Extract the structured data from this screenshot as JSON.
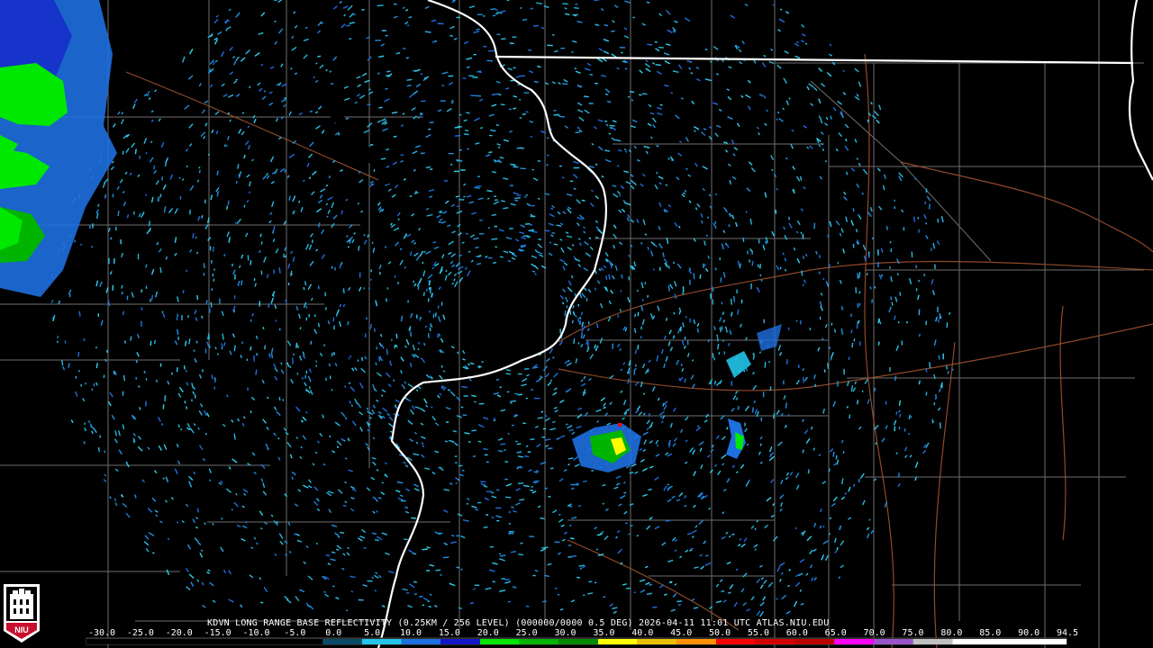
{
  "product": {
    "caption": "KDVN LONG RANGE BASE REFLECTIVITY (0.25KM / 256 LEVEL) (000000/0000 0.5 DEG) 2026-04-11 11:01 UTC  ATLAS.NIU.EDU"
  },
  "logo": {
    "text": "NIU",
    "icon": "niu-tower-logo-icon"
  },
  "scale": {
    "min": -30.0,
    "max": 94.5,
    "tick_labels": [
      "-30.0",
      "-25.0",
      "-20.0",
      "-15.0",
      "-10.0",
      "-5.0",
      "0.0",
      "5.0",
      "10.0",
      "15.0",
      "20.0",
      "25.0",
      "30.0",
      "35.0",
      "40.0",
      "45.0",
      "50.0",
      "55.0",
      "60.0",
      "65.0",
      "70.0",
      "75.0",
      "80.0",
      "85.0",
      "90.0",
      "94.5"
    ],
    "colors": [
      {
        "from": -30,
        "to": 0,
        "color": "#000000"
      },
      {
        "from": 0,
        "to": 5,
        "color": "#0a4a66"
      },
      {
        "from": 5,
        "to": 10,
        "color": "#22c4e8"
      },
      {
        "from": 10,
        "to": 15,
        "color": "#1e6fe0"
      },
      {
        "from": 15,
        "to": 20,
        "color": "#1414c8"
      },
      {
        "from": 20,
        "to": 25,
        "color": "#00e800"
      },
      {
        "from": 25,
        "to": 30,
        "color": "#00b400"
      },
      {
        "from": 30,
        "to": 35,
        "color": "#008800"
      },
      {
        "from": 35,
        "to": 40,
        "color": "#ffff00"
      },
      {
        "from": 40,
        "to": 45,
        "color": "#e8c000"
      },
      {
        "from": 45,
        "to": 50,
        "color": "#ff9000"
      },
      {
        "from": 50,
        "to": 55,
        "color": "#ff0000"
      },
      {
        "from": 55,
        "to": 60,
        "color": "#d40000"
      },
      {
        "from": 60,
        "to": 65,
        "color": "#bc0000"
      },
      {
        "from": 65,
        "to": 70,
        "color": "#ff00ff"
      },
      {
        "from": 70,
        "to": 75,
        "color": "#9955c9"
      },
      {
        "from": 75,
        "to": 80,
        "color": "#c0c0c0"
      },
      {
        "from": 80,
        "to": 94.5,
        "color": "#ffffff"
      }
    ]
  },
  "map_colors": {
    "background": "#000000",
    "state_border": "#ffffff",
    "county_line": "#8a8a8a",
    "highway": "#a0522d",
    "clutter": "#27b7df"
  }
}
